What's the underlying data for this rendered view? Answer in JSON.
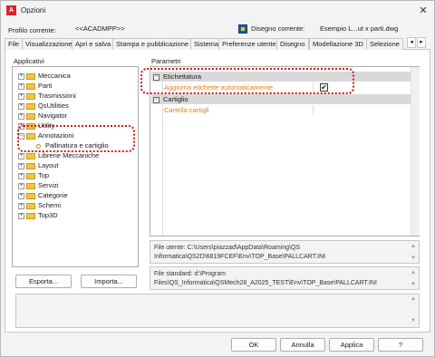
{
  "window": {
    "title": "Opzioni",
    "app_icon_text": "A",
    "close_glyph": "✕"
  },
  "header": {
    "profile_label": "Profilo corrente:",
    "profile_value": "<<ACADMPP>>",
    "drawing_label": "Disegno corrente:",
    "drawing_value": "Esempio L...ut x parti.dwg"
  },
  "tabs": [
    {
      "label": "File"
    },
    {
      "label": "Visualizzazione"
    },
    {
      "label": "Apri e salva"
    },
    {
      "label": "Stampa e pubblicazione"
    },
    {
      "label": "Sistema"
    },
    {
      "label": "Preferenze utente"
    },
    {
      "label": "Disegno"
    },
    {
      "label": "Modellazione 3D"
    },
    {
      "label": "Selezione"
    }
  ],
  "tab_scroll": {
    "left": "◂",
    "right": "▸"
  },
  "applicativi": {
    "label": "Applicativi",
    "items": [
      {
        "label": "Meccanica",
        "expander": "+"
      },
      {
        "label": "Parti",
        "expander": "+"
      },
      {
        "label": "Trasmissioni",
        "expander": "+"
      },
      {
        "label": "QsUtilities",
        "expander": "+"
      },
      {
        "label": "Navigator",
        "expander": "+"
      },
      {
        "label": "Utility",
        "expander": "+"
      },
      {
        "label": "Annotazioni",
        "expander": "−"
      },
      {
        "label": "Pallinatura e cartiglio",
        "expander": ""
      },
      {
        "label": "Librerie Meccaniche",
        "expander": "+"
      },
      {
        "label": "Layout",
        "expander": "+"
      },
      {
        "label": "Top",
        "expander": "+"
      },
      {
        "label": "Servizi",
        "expander": "+"
      },
      {
        "label": "Categorie",
        "expander": "+"
      },
      {
        "label": "Schemi",
        "expander": "+"
      },
      {
        "label": "Top3D",
        "expander": "+"
      }
    ],
    "export_button": "Esporta...",
    "import_button": "Importa..."
  },
  "parametri": {
    "label": "Parametri",
    "categories": [
      {
        "label": "Etichettatura",
        "toggle": "−",
        "properties": [
          {
            "name": "Aggiorna etichette automaticamente",
            "checked": true,
            "check_glyph": "✔"
          }
        ]
      },
      {
        "label": "Cartiglio",
        "toggle": "−",
        "properties": [
          {
            "name": "Cartella cartigli"
          }
        ]
      }
    ]
  },
  "paths": {
    "user_file": "File utente: C:\\Users\\piazzad\\AppData\\Roaming\\QS Informatica\\QS2D\\6819FCEF\\Env\\TOP_Base\\PALLCART.INI",
    "standard_file": "File standard: d:\\Program Files\\QS_Informatica\\QSMech28_A2025_TEST\\Env\\TOP_Base\\PALLCART.INI",
    "scroll_up": "▲",
    "scroll_down": "▼"
  },
  "footer": {
    "ok": "OK",
    "cancel": "Annulla",
    "apply": "Applica",
    "help": "?"
  },
  "colors": {
    "highlight_ring": "#d71919",
    "property_text": "#e8820c",
    "category_bg": "#d9d9d9"
  }
}
